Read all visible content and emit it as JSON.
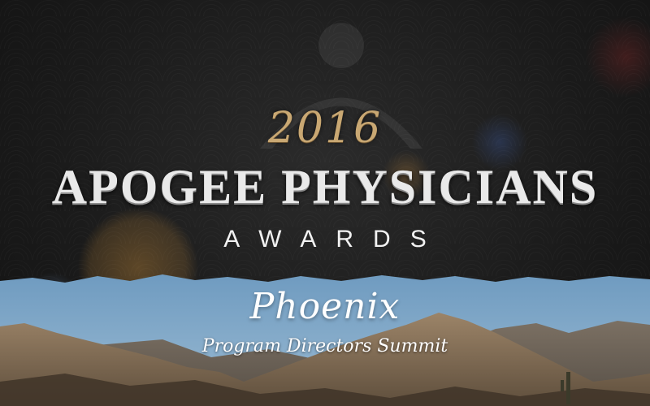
{
  "banner": {
    "year": "2016",
    "title": "APOGEE PHYSICIANS",
    "subtitle": "AWARDS",
    "city": "Phoenix",
    "event": "Program Directors Summit"
  },
  "colors": {
    "background": "#141414",
    "gold": "#c9a873",
    "sky": "#7aa6c8",
    "mountain": "#8a7560"
  },
  "icons": {
    "logo": "apogee-arc-logo-icon"
  }
}
